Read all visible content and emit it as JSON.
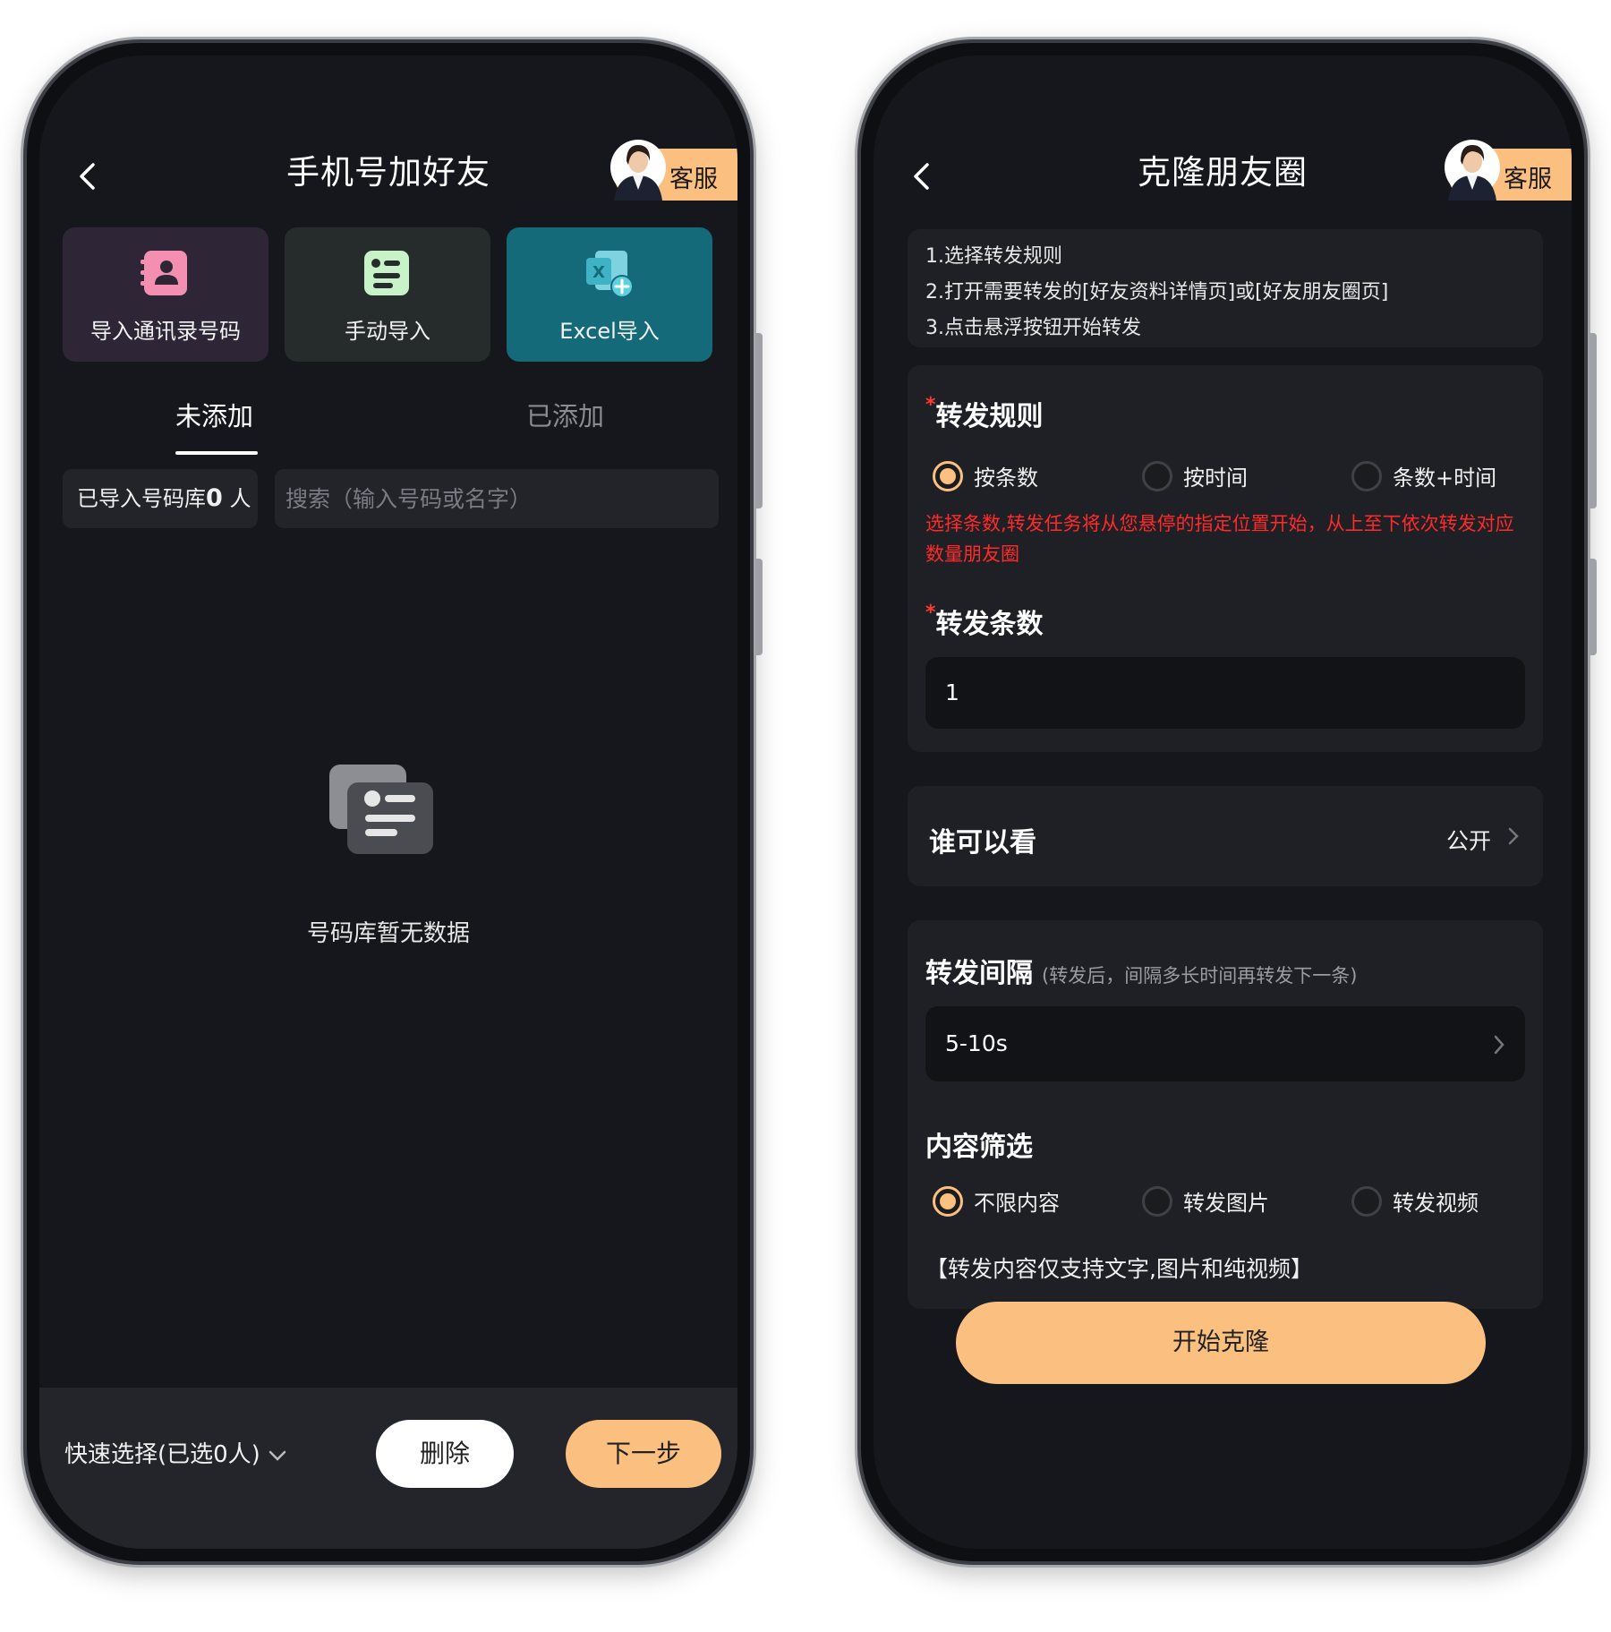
{
  "left": {
    "title": "手机号加好友",
    "customer_service": "客服",
    "import_options": [
      {
        "label": "导入通讯录号码",
        "icon": "contact-card-icon",
        "color": "#2e2636"
      },
      {
        "label": "手动导入",
        "icon": "document-list-icon",
        "color": "#252c2b"
      },
      {
        "label": "Excel导入",
        "icon": "excel-add-icon",
        "color": "#156a7a"
      }
    ],
    "tabs": [
      {
        "label": "未添加",
        "active": true
      },
      {
        "label": "已添加",
        "active": false
      }
    ],
    "library_prefix": "已导入号码库",
    "library_count": "0",
    "library_suffix": "人",
    "search_placeholder": "搜索（输入号码或名字）",
    "empty_text": "号码库暂无数据",
    "quick_select": "快速选择(已选0人)",
    "delete_label": "删除",
    "next_label": "下一步"
  },
  "right": {
    "title": "克隆朋友圈",
    "customer_service": "客服",
    "steps": [
      "1.选择转发规则",
      "2.打开需要转发的[好友资料详情页]或[好友朋友圈页]",
      "3.点击悬浮按钮开始转发"
    ],
    "rule_title": "转发规则",
    "rule_options": [
      {
        "label": "按条数",
        "selected": true
      },
      {
        "label": "按时间",
        "selected": false
      },
      {
        "label": "条数+时间",
        "selected": false
      }
    ],
    "rule_warning": "选择条数,转发任务将从您悬停的指定位置开始，从上至下依次转发对应数量朋友圈",
    "count_title": "转发条数",
    "count_value": "1",
    "visibility_label": "谁可以看",
    "visibility_value": "公开",
    "interval_title": "转发间隔",
    "interval_hint": "(转发后，间隔多长时间再转发下一条)",
    "interval_value": "5-10s",
    "filter_title": "内容筛选",
    "filter_options": [
      {
        "label": "不限内容",
        "selected": true
      },
      {
        "label": "转发图片",
        "selected": false
      },
      {
        "label": "转发视频",
        "selected": false
      }
    ],
    "filter_note": "【转发内容仅支持文字,图片和纯视频】",
    "start_label": "开始克隆"
  },
  "colors": {
    "accent": "#fbbf7f",
    "background": "#15171c",
    "card": "#1e2025",
    "warning": "#ff2a2a"
  }
}
